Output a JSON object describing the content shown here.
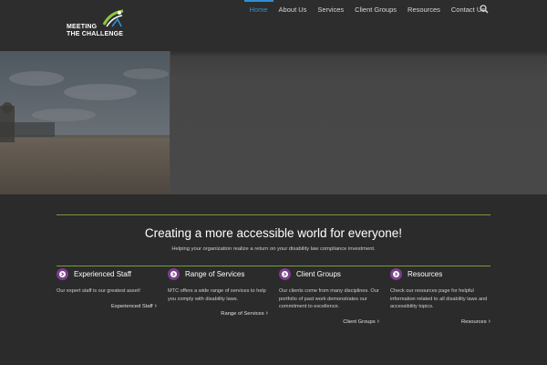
{
  "logo": {
    "line1": "MEETING",
    "line2": "THE CHALLENGE"
  },
  "nav": {
    "items": [
      {
        "label": "Home",
        "active": true
      },
      {
        "label": "About Us",
        "active": false
      },
      {
        "label": "Services",
        "active": false
      },
      {
        "label": "Client Groups",
        "active": false
      },
      {
        "label": "Resources",
        "active": false
      },
      {
        "label": "Contact Us",
        "active": false
      }
    ],
    "search_icon": "search-icon"
  },
  "colors": {
    "active_nav": "#2f8fd8",
    "divider": "#7a9a3a",
    "feature_icon": "#7b3f8c",
    "background": "#2b2b2b"
  },
  "main": {
    "tagline": "Creating a more accessible world for everyone!",
    "subtagline": "Helping your organization realize a return on your disability law compliance investment."
  },
  "features": [
    {
      "title": "Experienced Staff",
      "text": "Our expert staff is our greatest asset!",
      "link": "Experienced Staff",
      "icon": "arrow-circle-icon"
    },
    {
      "title": "Range of Services",
      "text": "MTC offers a wide range of services to help you comply with disability laws.",
      "link": "Range of Services",
      "icon": "arrow-circle-icon"
    },
    {
      "title": "Client Groups",
      "text": "Our clients come from many disciplines. Our portfolio of past work demonstrates our commitment to excellence.",
      "link": "Client Groups",
      "icon": "arrow-circle-icon"
    },
    {
      "title": "Resources",
      "text": "Check our resources page for helpful information related to all disability laws and accessibility topics.",
      "link": "Resources",
      "icon": "arrow-circle-icon"
    }
  ],
  "link_arrow": "›"
}
